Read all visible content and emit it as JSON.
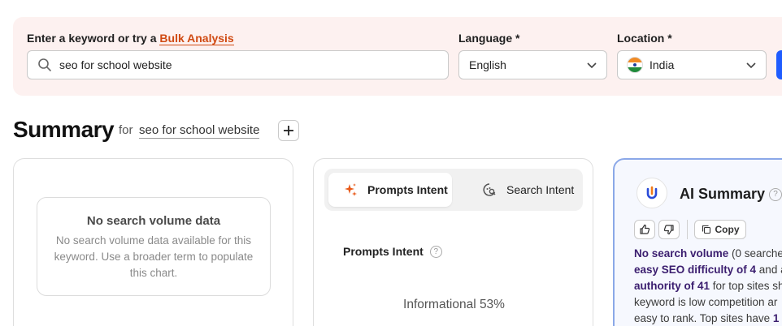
{
  "search": {
    "keyword_label_prefix": "Enter a keyword or try a",
    "bulk_link": "Bulk Analysis",
    "keyword_value": "seo for school website",
    "language_label": "Language *",
    "language_value": "English",
    "location_label": "Location *",
    "location_value": "India"
  },
  "summary": {
    "title": "Summary",
    "for_text": "for",
    "keyword": "seo for school website"
  },
  "volume_card": {
    "empty_title": "No search volume data",
    "empty_desc": "No search volume data available for this keyword. Use a broader term to populate this chart."
  },
  "intent_card": {
    "tabs": [
      "Prompts Intent",
      "Search Intent"
    ],
    "section_label": "Prompts Intent",
    "value_text": "Informational 53%"
  },
  "ai_card": {
    "title": "AI Summary",
    "copy_label": "Copy",
    "line1_bold": "No search volume",
    "line1_rest": " (0 searche",
    "line2_bold": "easy SEO difficulty of 4",
    "line2_rest": " and a",
    "line3_bold": "authority of 41",
    "line3_rest": " for top sites sh",
    "line4": "keyword is low competition ar",
    "line5_start": "easy to rank. Top sites have ",
    "line5_bold": "1"
  },
  "colors": {
    "accent_link": "#d04a12",
    "primary_button": "#1f5cff",
    "ai_border": "#8ba8e8"
  },
  "icons": [
    "search-icon",
    "chevron-down-icon",
    "india-flag-icon",
    "plus-icon",
    "sparkle-icon",
    "search-intent-icon",
    "help-icon",
    "ai-logo-icon",
    "thumbs-up-icon",
    "thumbs-down-icon",
    "copy-icon"
  ]
}
